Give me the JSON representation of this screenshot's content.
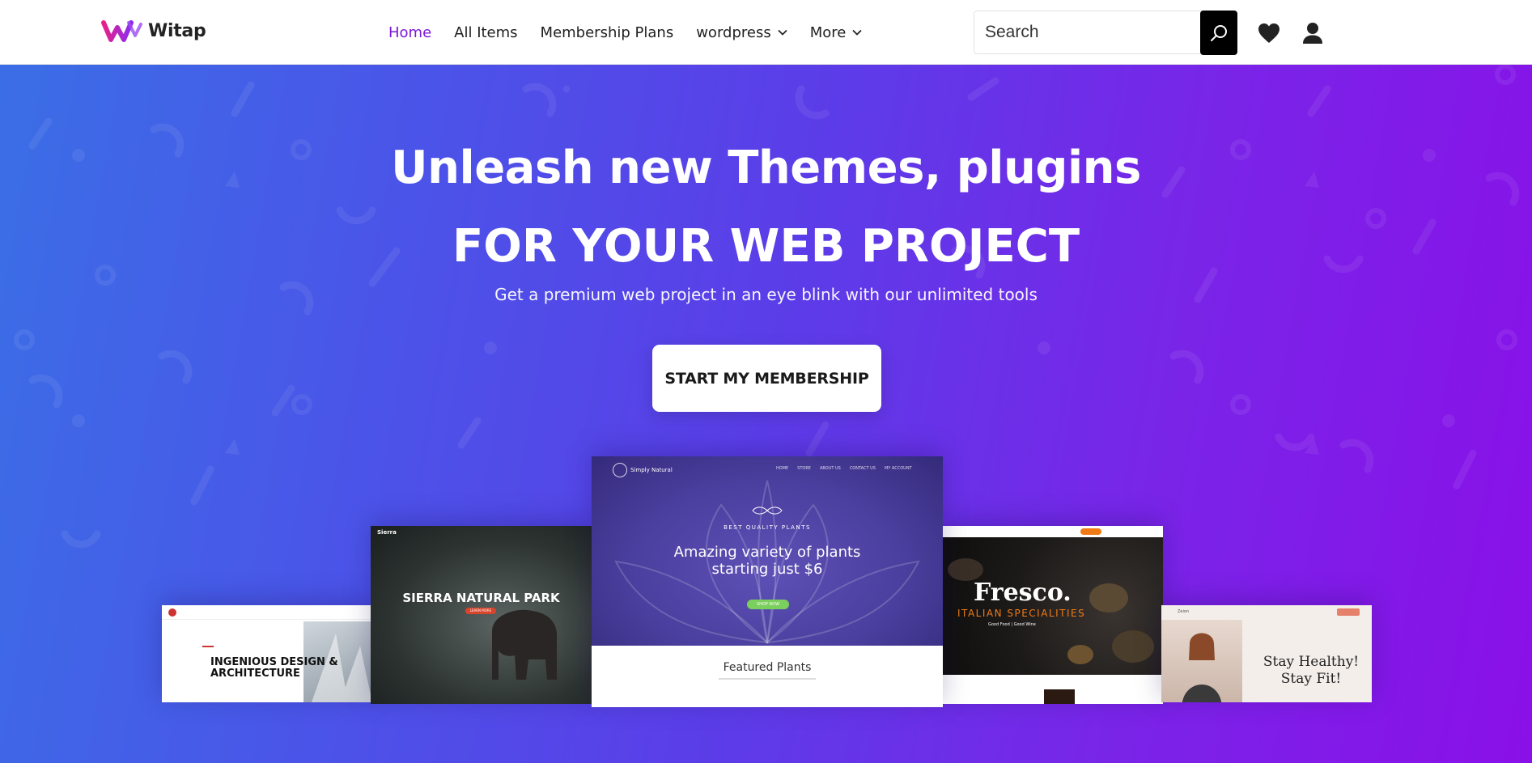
{
  "brand": {
    "name": "Witap",
    "accent": "#7b16d8"
  },
  "nav": {
    "items": [
      {
        "label": "Home",
        "active": true
      },
      {
        "label": "All Items"
      },
      {
        "label": "Membership Plans"
      },
      {
        "label": "wordpress",
        "dropdown": true
      },
      {
        "label": "More",
        "dropdown": true
      }
    ]
  },
  "search": {
    "placeholder": "Search",
    "icon": "search-icon"
  },
  "header_icons": [
    "heart-icon",
    "user-icon"
  ],
  "hero": {
    "title": "Unleash new Themes, plugins",
    "subtitle": "FOR YOUR WEB PROJECT",
    "tagline": "Get a premium web project in an eye blink with our unlimited tools",
    "cta_label": "START MY MEMBERSHIP",
    "gradient": [
      "#3b6ee6",
      "#8a10e8"
    ]
  },
  "showcase": {
    "shot1": {
      "headline": "INGENIOUS DESIGN & ARCHITECTURE"
    },
    "shot2": {
      "brand": "Sierra",
      "headline": "SIERRA NATURAL PARK",
      "button": "LEARN MORE"
    },
    "shot3": {
      "brand": "Simply Natural",
      "menu": [
        "HOME",
        "STORE",
        "ABOUT US",
        "CONTACT US",
        "MY ACCOUNT"
      ],
      "kicker": "BEST QUALITY PLANTS",
      "headline_line1": "Amazing variety of plants",
      "headline_line2": "starting just $6",
      "button": "SHOP NOW",
      "section": "Featured Plants"
    },
    "shot4": {
      "headline": "Fresco.",
      "sub": "ITALIAN SPECIALITIES",
      "tag": "Good Food | Good Wine"
    },
    "shot5": {
      "brand": "Zeion",
      "headline_line1": "Stay Healthy!",
      "headline_line2": "Stay Fit!"
    }
  }
}
